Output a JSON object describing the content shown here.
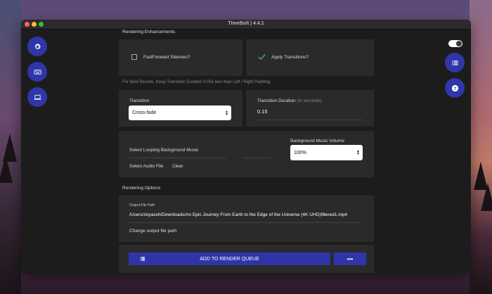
{
  "window": {
    "title": "TimeBolt | 4.4.1"
  },
  "sections": {
    "rendering_enhancements": "Rendering Enhancements",
    "rendering_options": "Rendering Options"
  },
  "enhancements": {
    "fastforward_label": "FastForward Silences?",
    "fastforward_checked": false,
    "transitions_label": "Apply Transitions?",
    "transitions_checked": true,
    "hint": "For Best Results, Keep Transition Duration 0.05x less than Left / Right Padding."
  },
  "transition": {
    "label": "Transition",
    "selected": "Cross-fade",
    "duration_label": "Transition Duration",
    "duration_unit": "(in seconds)",
    "duration_value": "0.15"
  },
  "music": {
    "select_label": "Select Looping Background Music",
    "select_audio_file": "Select Audio File",
    "clear": "Clear",
    "volume_label": "Background Music Volume",
    "volume_selected": "100%"
  },
  "output": {
    "path_label": "Output File Path",
    "path_value": "/Users/zeyassh/Downloads/An Epic Journey From Earth to the Edge of the Universe (4K UHD)filtered1.mp4",
    "change_label": "Change output file path"
  },
  "actions": {
    "add_to_queue": "ADD TO RENDER QUEUE",
    "more": "•••"
  },
  "colors": {
    "accent": "#2f35a8",
    "check": "#3fae8c"
  }
}
